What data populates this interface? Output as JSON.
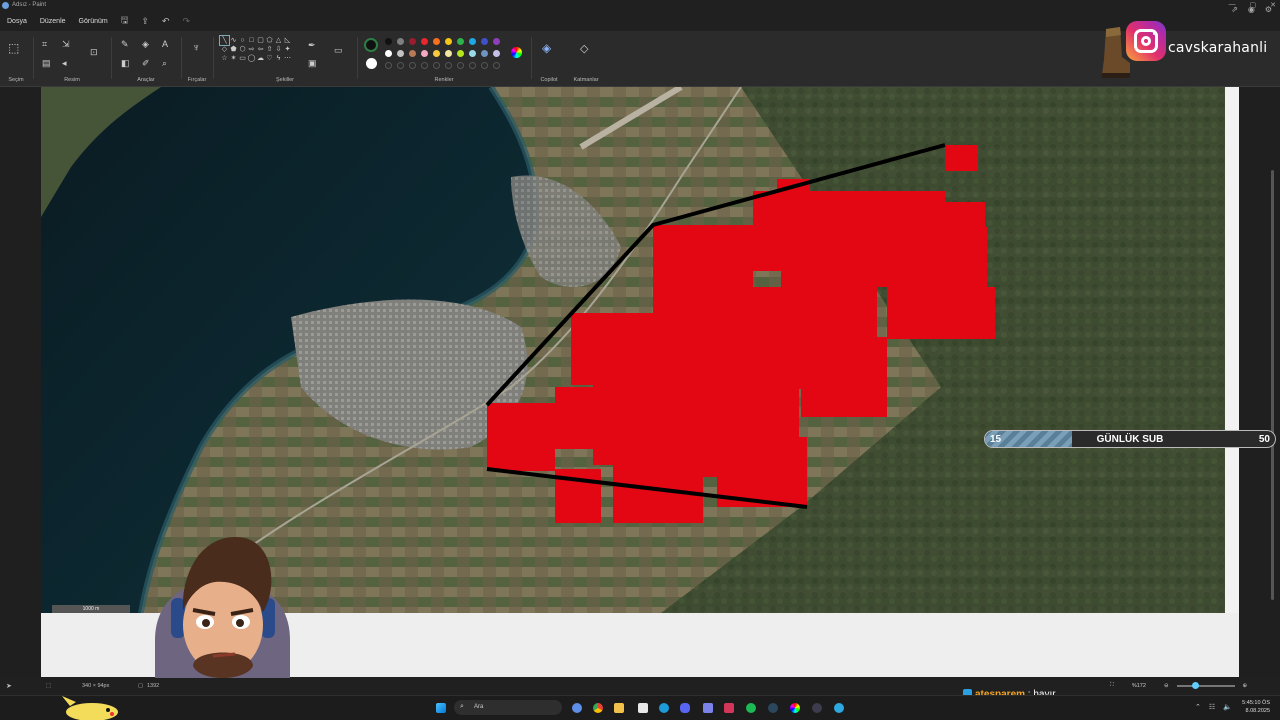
{
  "window": {
    "title": "Adsız - Paint"
  },
  "menu": {
    "file": "Dosya",
    "edit": "Düzenle",
    "view": "Görünüm"
  },
  "ribbon": {
    "groups": {
      "selection": "Seçim",
      "image": "Resim",
      "tools": "Araçlar",
      "brushes": "Fırçalar",
      "shapes": "Şekiller",
      "colors": "Renkler",
      "copilot": "Copilot",
      "layers": "Katmanlar"
    },
    "colors": {
      "primary": "#111111",
      "secondary": "#ffffff",
      "palette_row1": [
        "#111111",
        "#7f7f7f",
        "#9b1c2e",
        "#e8262e",
        "#f7701f",
        "#f5c518",
        "#2eb24b",
        "#1ea7e1",
        "#3f51c8",
        "#8e3fb8"
      ],
      "palette_row2": [
        "#ffffff",
        "#c3c3c3",
        "#b97a57",
        "#f4a8c4",
        "#f9c83e",
        "#f2e6a3",
        "#b5e61d",
        "#99d9ea",
        "#7092be",
        "#c8bfe7"
      ]
    }
  },
  "overlay": {
    "instagram_handle": "cavskarahanli",
    "sub_goal": {
      "current": "15",
      "label": "GÜNLÜK SUB",
      "target": "50",
      "progress": 0.3
    },
    "chat": {
      "user": "atesparem",
      "message": "hayır"
    }
  },
  "map": {
    "scale_label": "1000 m",
    "mark_color": "#e30613",
    "line_color": "#000000"
  },
  "status": {
    "selection_size": "340 × 94px",
    "canvas_size": "1392",
    "zoom": "%172"
  },
  "taskbar": {
    "search_placeholder": "Ara"
  },
  "clock": {
    "time": "5:45:10 ÖS",
    "date": "8.08.2025"
  }
}
